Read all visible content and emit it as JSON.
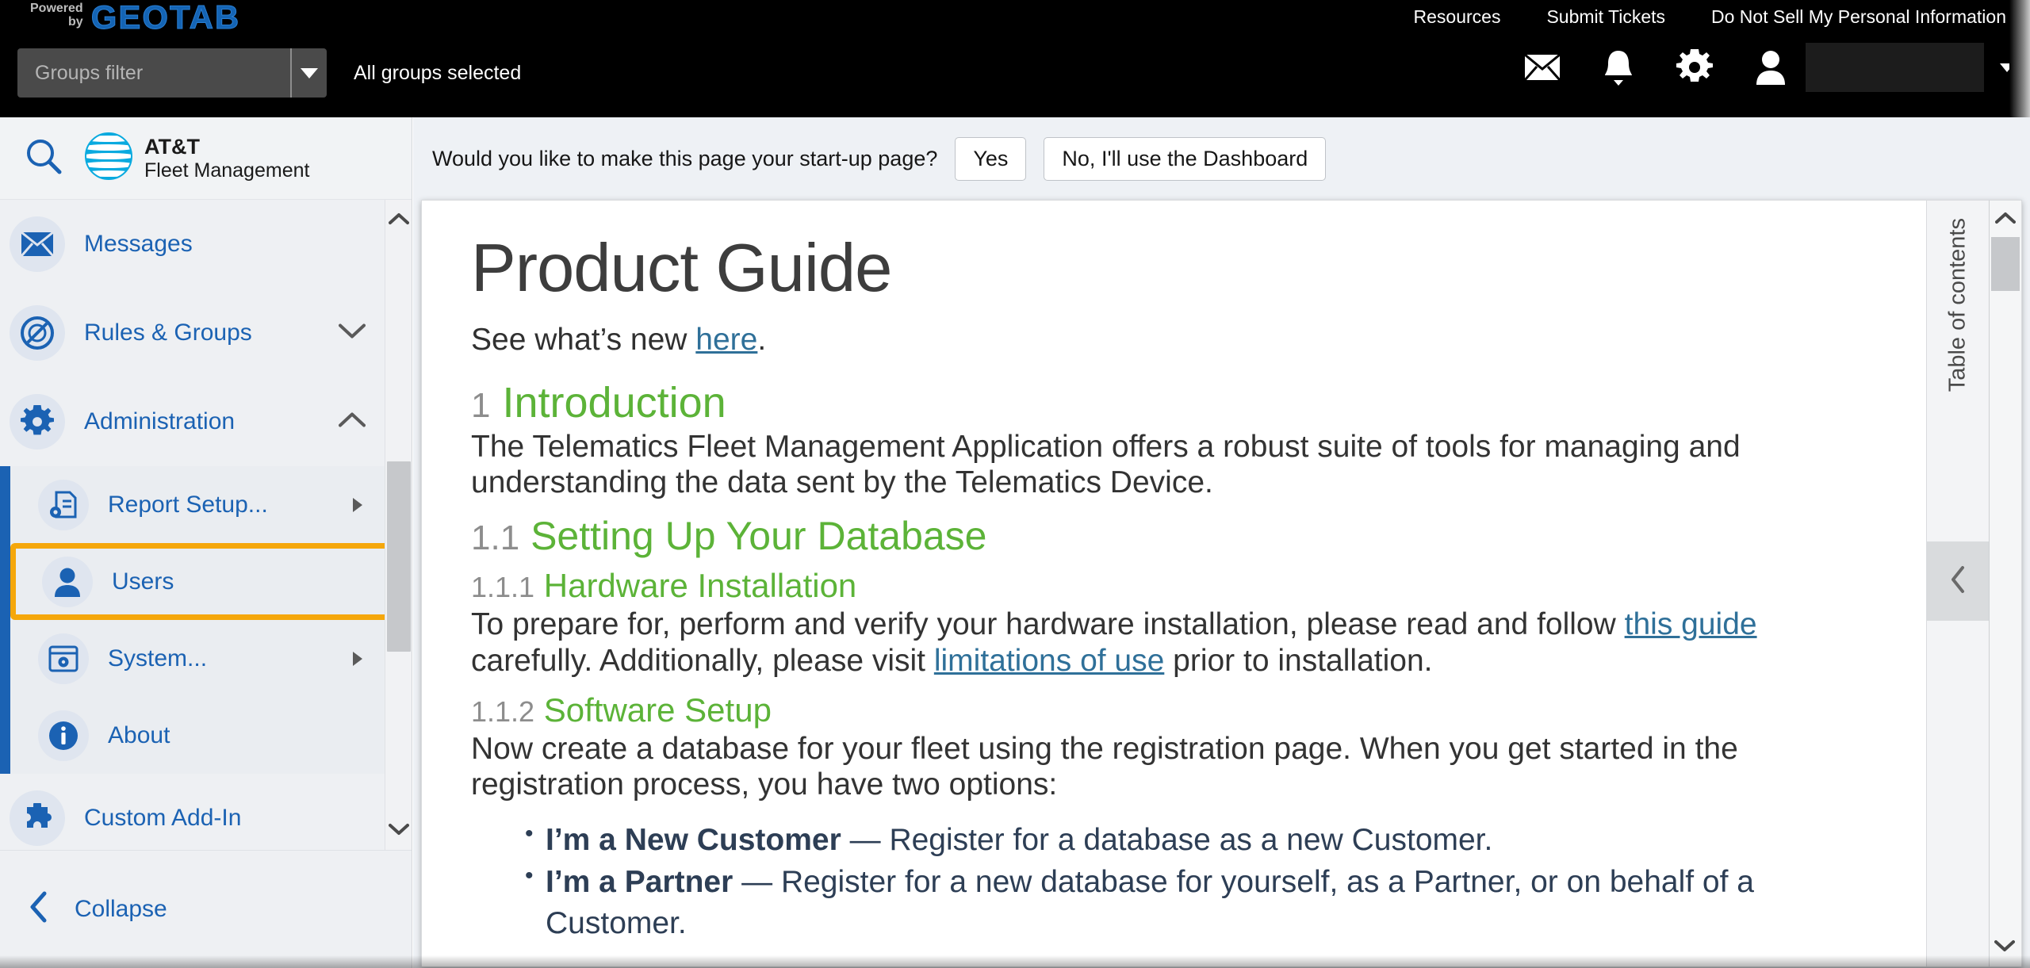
{
  "topbar": {
    "powered_line1": "Powered",
    "powered_line2": "by",
    "brand": "GEOTAB",
    "links": [
      {
        "label": "Resources",
        "name": "resources"
      },
      {
        "label": "Submit Tickets",
        "name": "submit-tickets"
      },
      {
        "label": "Do Not Sell My Personal Information",
        "name": "do-not-sell"
      }
    ],
    "groups_filter_placeholder": "Groups filter",
    "groups_filter_value": "",
    "all_groups_status": "All groups selected",
    "icons": [
      "mail-icon",
      "bell-icon",
      "gear-icon",
      "user-icon"
    ],
    "brand_color": "#1464b4"
  },
  "sidebar": {
    "search_icon": "search-icon",
    "brand_line1": "AT&T",
    "brand_line2": "Fleet Management",
    "items": [
      {
        "label": "Messages",
        "icon": "mail-icon",
        "expandable": false
      },
      {
        "label": "Rules & Groups",
        "icon": "rules-icon",
        "expandable": true,
        "expanded": false
      },
      {
        "label": "Administration",
        "icon": "gear-icon",
        "expandable": true,
        "expanded": true
      }
    ],
    "admin_submenu": [
      {
        "label": "Report Setup...",
        "icon": "report-setup-icon",
        "has_arrow": true,
        "selected": false
      },
      {
        "label": "Users",
        "icon": "user-icon",
        "has_arrow": false,
        "selected": true
      },
      {
        "label": "System...",
        "icon": "system-icon",
        "has_arrow": true,
        "selected": false
      },
      {
        "label": "About",
        "icon": "info-icon",
        "has_arrow": false,
        "selected": false
      }
    ],
    "addin": {
      "label": "Custom Add-In",
      "icon": "puzzle-icon"
    },
    "collapse": {
      "label": "Collapse",
      "icon": "chevron-left-icon"
    },
    "selection_highlight_color": "#f5a70b",
    "accent_color": "#1b62b3"
  },
  "startup_prompt": {
    "question": "Would you like to make this page your start-up page?",
    "yes_label": "Yes",
    "no_label": "No, I'll use the Dashboard"
  },
  "document": {
    "title": "Product Guide",
    "subline_before": "See what’s new ",
    "subline_link": "here",
    "subline_after": ".",
    "sections": [
      {
        "num": "1",
        "heading": "Introduction",
        "paragraph": "The Telematics Fleet Management Application offers a robust suite of tools for managing and understanding the data sent by the Telematics Device."
      },
      {
        "num": "1.1",
        "heading": "Setting Up Your Database"
      },
      {
        "num": "1.1.1",
        "heading": "Hardware Installation",
        "p_a": "To prepare for, perform and verify your hardware installation, please read and follow ",
        "link_a": "this guide",
        "p_b": " carefully. Additionally, please visit ",
        "link_b": "limitations of use",
        "p_c": " prior to installation."
      },
      {
        "num": "1.1.2",
        "heading": "Software Setup",
        "paragraph": "Now create a database for your fleet using the registration page. When you get started in the registration process, you have two options:",
        "options": [
          {
            "bold": "I’m a New Customer",
            "rest": " — Register for a database as a new Customer."
          },
          {
            "bold": "I’m a Partner",
            "rest": " — Register for a new database for yourself, as a Partner, or on behalf of a Customer."
          }
        ]
      }
    ],
    "heading_color": "#5cb338",
    "link_color": "#2f7099"
  },
  "toc": {
    "label": "Table of contents",
    "collapse_icon": "chevron-left-icon"
  }
}
